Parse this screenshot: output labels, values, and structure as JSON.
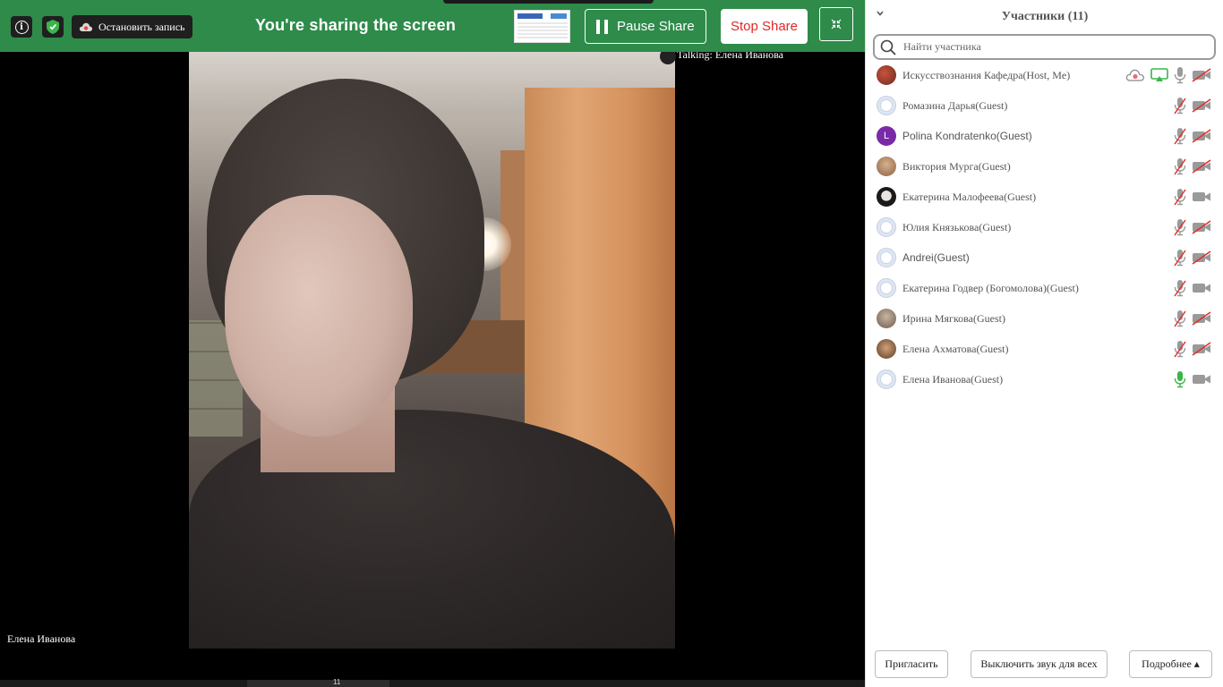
{
  "share_bar": {
    "record_label": "Остановить запись",
    "title": "You're sharing the screen",
    "pause_label": "Pause Share",
    "stop_label": "Stop Share",
    "bg_color": "#2e8b4a",
    "stop_color": "#e02828"
  },
  "video": {
    "talking": "Talking: Елена Иванова",
    "speaker_name": "Елена Иванова"
  },
  "toolbar": {
    "participants_count": "11"
  },
  "panel": {
    "title": "Участники (11)",
    "search_placeholder": "Найти участника",
    "participants": [
      {
        "name": "Искусствознания Кафедра(Host, Me)",
        "avatar": "photo",
        "icons": [
          "record-icon",
          "screen-share-icon",
          "mic-icon",
          "video-off-icon"
        ]
      },
      {
        "name": "Ромазина Дарья(Guest)",
        "avatar": "default",
        "icons": [
          "mic-muted-icon",
          "video-off-icon"
        ]
      },
      {
        "name": "Polina Kondratenko(Guest)",
        "avatar": "L",
        "icons": [
          "mic-muted-icon",
          "video-off-icon"
        ]
      },
      {
        "name": "Виктория Мурга(Guest)",
        "avatar": "photo",
        "icons": [
          "mic-muted-icon",
          "video-off-icon"
        ]
      },
      {
        "name": "Екатерина Малофеева(Guest)",
        "avatar": "photo",
        "icons": [
          "mic-muted-icon",
          "video-icon"
        ]
      },
      {
        "name": "Юлия Князькова(Guest)",
        "avatar": "default",
        "icons": [
          "mic-muted-icon",
          "video-off-icon"
        ]
      },
      {
        "name": "Andrei(Guest)",
        "avatar": "default",
        "icons": [
          "mic-muted-icon",
          "video-off-icon"
        ]
      },
      {
        "name": "Екатерина Годвер (Богомолова)(Guest)",
        "avatar": "default",
        "icons": [
          "mic-muted-icon",
          "video-icon"
        ]
      },
      {
        "name": "Ирина Мягкова(Guest)",
        "avatar": "photo",
        "icons": [
          "mic-muted-icon",
          "video-off-icon"
        ]
      },
      {
        "name": "Елена Ахматова(Guest)",
        "avatar": "photo",
        "icons": [
          "mic-muted-icon",
          "video-off-icon"
        ]
      },
      {
        "name": "Елена Иванова(Guest)",
        "avatar": "default",
        "icons": [
          "mic-active-icon",
          "video-icon"
        ]
      }
    ],
    "invite_label": "Пригласить",
    "mute_all_label": "Выключить звук для всех",
    "more_label": "Подробнее ▴",
    "mic_active_color": "#3bb54a",
    "share_icon_color": "#3bb54a",
    "muted_slash_color": "#e0302a"
  }
}
